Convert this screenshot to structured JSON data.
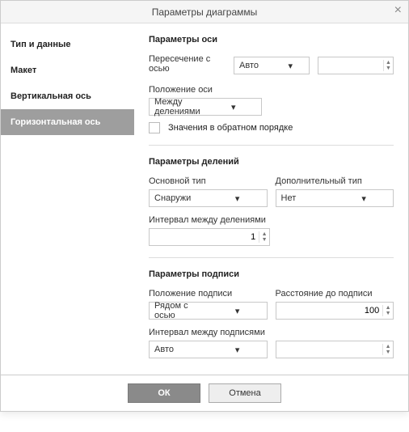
{
  "title": "Параметры диаграммы",
  "sidebar": {
    "items": [
      {
        "label": "Тип и данные"
      },
      {
        "label": "Макет"
      },
      {
        "label": "Вертикальная ось"
      },
      {
        "label": "Горизонтальная ось"
      }
    ],
    "activeIndex": 3
  },
  "axis": {
    "section_title": "Параметры оси",
    "cross_label": "Пересечение с осью",
    "cross_value": "Авто",
    "cross_num": "",
    "position_label": "Положение оси",
    "position_value": "Между делениями",
    "reverse_label": "Значения в обратном порядке"
  },
  "ticks": {
    "section_title": "Параметры делений",
    "major_label": "Основной тип",
    "major_value": "Снаружи",
    "minor_label": "Дополнительный тип",
    "minor_value": "Нет",
    "interval_label": "Интервал между делениями",
    "interval_value": "1"
  },
  "labels": {
    "section_title": "Параметры подписи",
    "position_label": "Положение подписи",
    "position_value": "Рядом с осью",
    "distance_label": "Расстояние до подписи",
    "distance_value": "100",
    "interval_label": "Интервал между подписями",
    "interval_mode": "Авто",
    "interval_value": ""
  },
  "footer": {
    "ok": "ОК",
    "cancel": "Отмена"
  }
}
